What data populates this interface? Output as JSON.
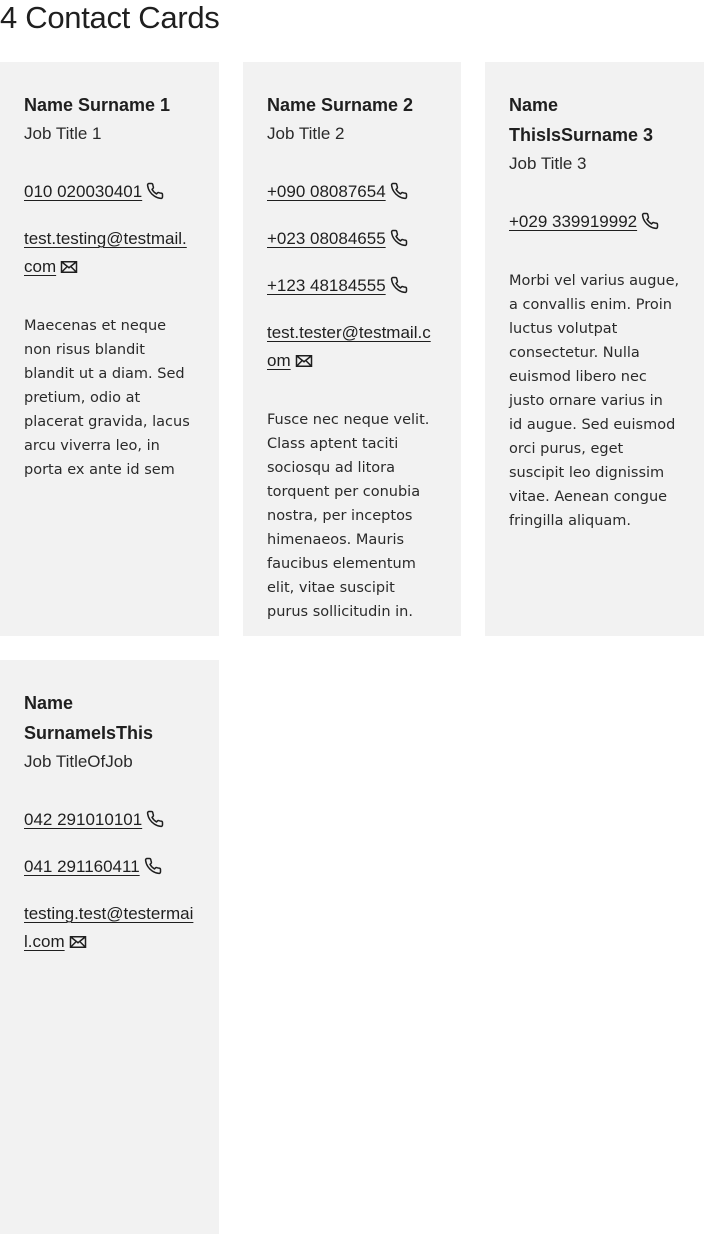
{
  "page": {
    "title": "4 Contact Cards"
  },
  "cards": [
    {
      "name": "Name Surname 1",
      "job": "Job Title 1",
      "phones": [
        "010 020030401"
      ],
      "email": "test.testing@testmail.com",
      "bio": "Maecenas et neque non risus blandit blandit ut a diam. Sed pretium, odio at placerat gravida, lacus arcu viverra leo, in porta ex ante id sem"
    },
    {
      "name": "Name Surname 2",
      "job": "Job Title 2",
      "phones": [
        "+090 08087654",
        "+023 08084655",
        "+123 48184555"
      ],
      "email": "test.tester@testmail.com",
      "bio": "Fusce nec neque velit. Class aptent taciti sociosqu ad litora torquent per conubia nostra, per inceptos himenaeos. Mauris faucibus elementum elit, vitae suscipit purus sollicitudin in."
    },
    {
      "name": "Name ThisIsSurname 3",
      "job": "Job Title 3",
      "phones": [
        "+029 339919992"
      ],
      "email": "",
      "bio": "Morbi vel varius augue, a convallis enim. Proin luctus volutpat consectetur. Nulla euismod libero nec justo ornare varius in id augue. Sed euismod orci purus, eget suscipit leo dignissim vitae. Aenean congue fringilla aliquam."
    },
    {
      "name": "Name SurnameIsThis",
      "job": "Job TitleOfJob",
      "phones": [
        "042 291010101",
        "041 291160411"
      ],
      "email": "testing.test@testermail.com",
      "bio": ""
    }
  ]
}
